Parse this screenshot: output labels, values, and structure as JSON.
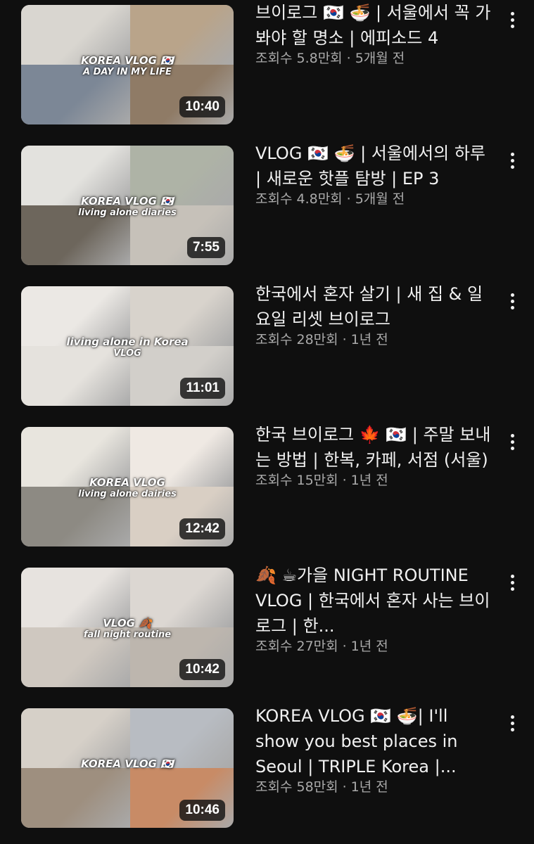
{
  "videos": [
    {
      "title": "브이로그 🇰🇷 🍜 | 서울에서 꼭 가봐야 할 명소 | 에피소드 4",
      "views": "조회수 5.8만회",
      "age": "5개월 전",
      "duration": "10:40",
      "overlay_main": "KOREA VLOG 🇰🇷",
      "overlay_sub": "A DAY IN MY LIFE",
      "colors": [
        "#d9d6d0",
        "#b9a48a",
        "#7c8796",
        "#8f7b66"
      ]
    },
    {
      "title": "VLOG 🇰🇷 🍜 | 서울에서의 하루 | 새로운 핫플 탐방 | EP 3",
      "views": "조회수 4.8만회",
      "age": "5개월 전",
      "duration": "7:55",
      "overlay_main": "KOREA VLOG 🇰🇷",
      "overlay_sub": "living alone diaries",
      "colors": [
        "#e3e2de",
        "#aeb3a6",
        "#6d665c",
        "#c6c1b9"
      ]
    },
    {
      "title": "한국에서 혼자 살기 | 새 집 & 일요일 리셋 브이로그",
      "views": "조회수 28만회",
      "age": "1년 전",
      "duration": "11:01",
      "overlay_main": "living alone in Korea",
      "overlay_sub": "VLOG",
      "colors": [
        "#ebe8e4",
        "#d8d3cc",
        "#e5e2dd",
        "#d2cfca"
      ]
    },
    {
      "title": "한국 브이로그 🍁 🇰🇷 | 주말 보내는 방법 | 한복, 카페, 서점 (서울)",
      "views": "조회수 15만회",
      "age": "1년 전",
      "duration": "12:42",
      "overlay_main": "KOREA VLOG",
      "overlay_sub": "living alone dairies",
      "colors": [
        "#e8e5de",
        "#efe9e3",
        "#8d8a83",
        "#d9cfc4"
      ]
    },
    {
      "title": "🍂 ☕가을 NIGHT ROUTINE VLOG | 한국에서 혼자 사는 브이로그 | 한...",
      "views": "조회수 27만회",
      "age": "1년 전",
      "duration": "10:42",
      "overlay_main": "VLOG 🍂",
      "overlay_sub": "fall night routine",
      "colors": [
        "#e7e3df",
        "#dcd7d2",
        "#cfc8c0",
        "#bdb6ae"
      ]
    },
    {
      "title": "KOREA VLOG 🇰🇷 🍜| I'll show you best places in Seoul | TRIPLE Korea |...",
      "views": "조회수 58만회",
      "age": "1년 전",
      "duration": "10:46",
      "overlay_main": "KOREA VLOG 🇰🇷",
      "overlay_sub": "",
      "colors": [
        "#d6d0c8",
        "#b8bcc2",
        "#9e8f7f",
        "#c88b66"
      ]
    }
  ],
  "icons": {
    "more": "more-vertical-icon"
  },
  "meta_separator": "·"
}
